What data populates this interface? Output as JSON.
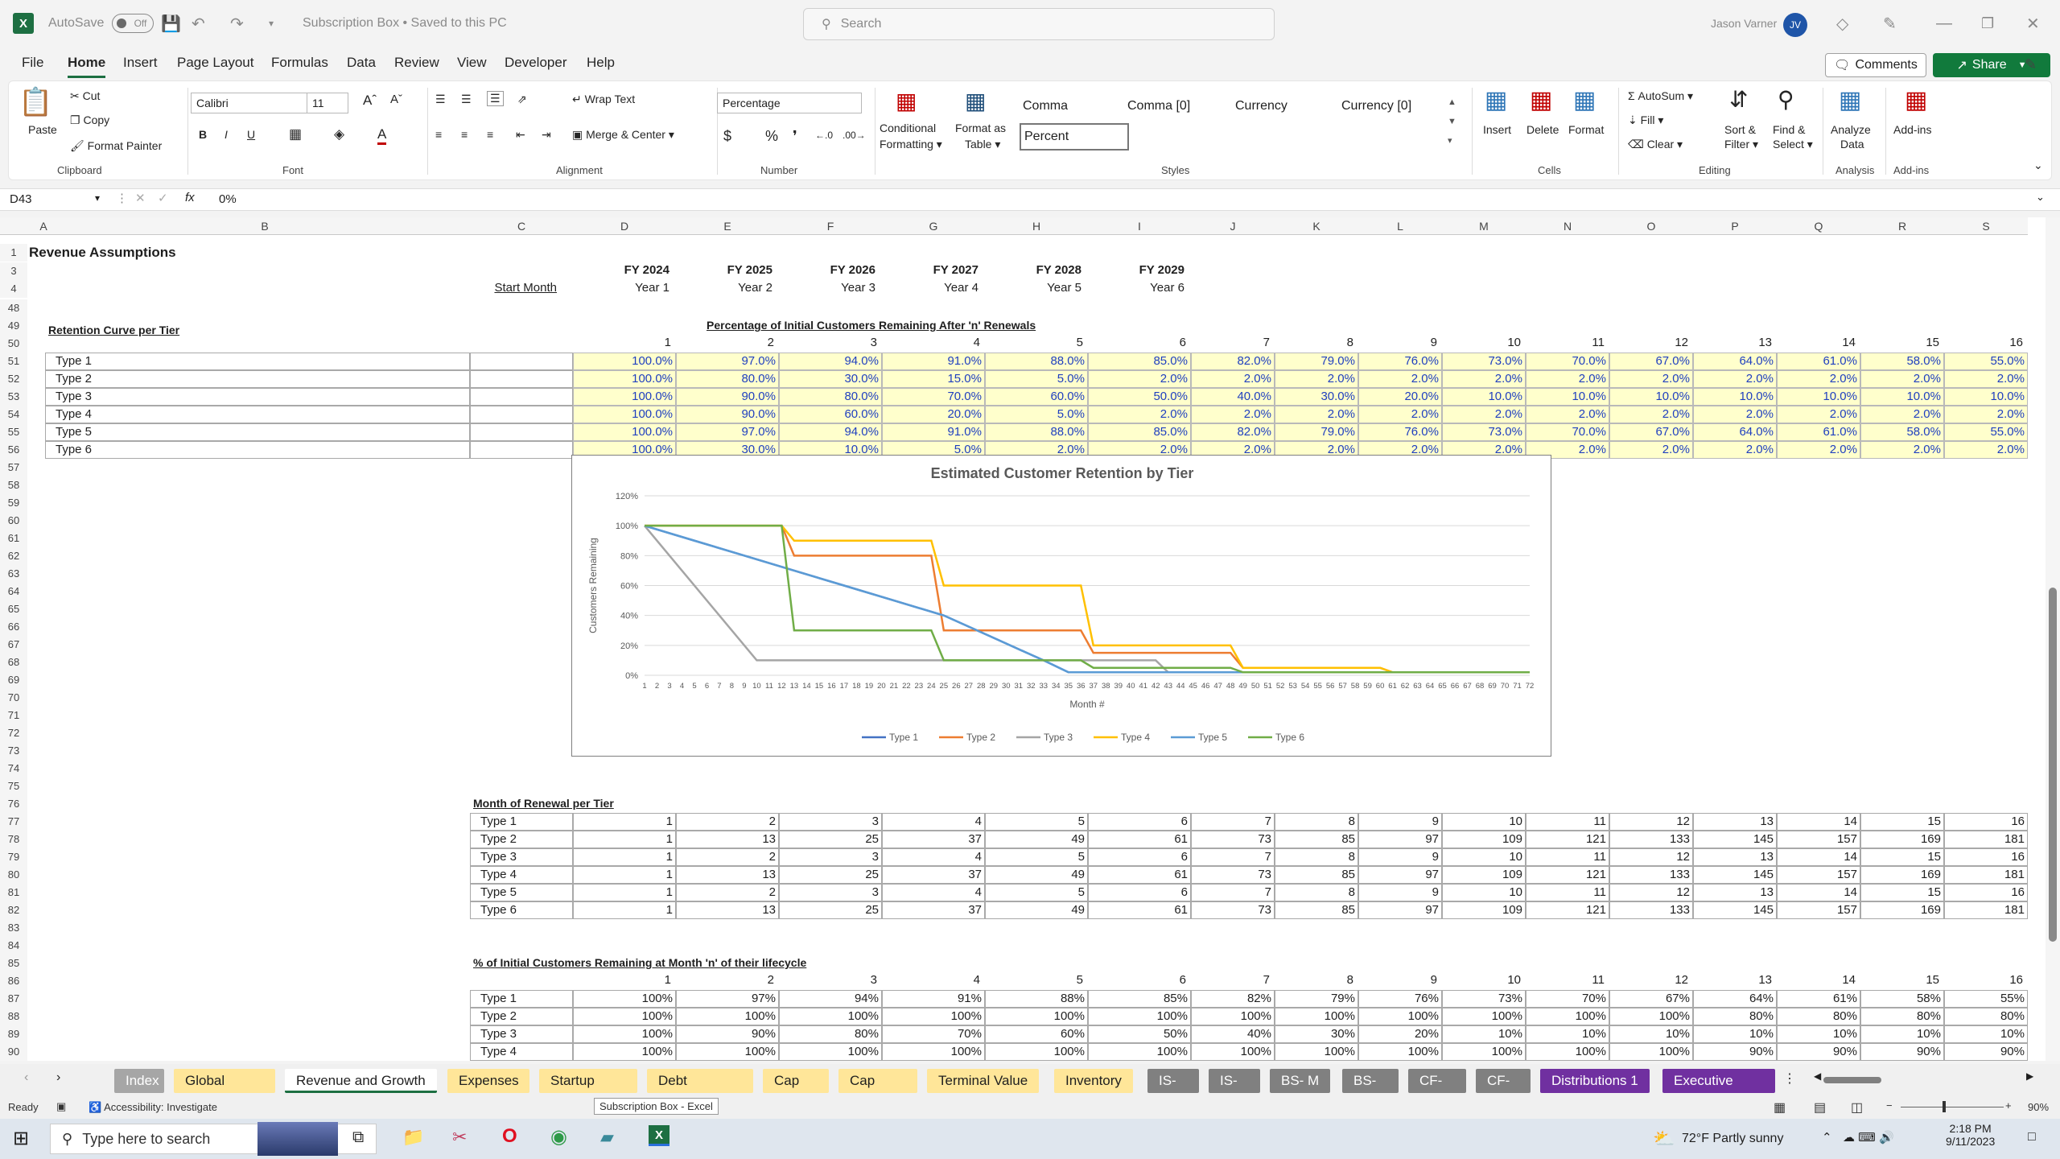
{
  "window": {
    "autosave_label": "AutoSave",
    "autosave_state": "Off",
    "title": "Subscription Box  •  Saved to this PC",
    "search_placeholder": "Search",
    "user_name": "Jason Varner",
    "user_initials": "JV"
  },
  "menu": {
    "tabs": [
      "File",
      "Home",
      "Insert",
      "Page Layout",
      "Formulas",
      "Data",
      "Review",
      "View",
      "Developer",
      "Help"
    ],
    "active": "Home",
    "comments": "Comments",
    "share": "Share"
  },
  "ribbon": {
    "clipboard": {
      "paste": "Paste",
      "cut": "Cut",
      "copy": "Copy",
      "format_painter": "Format Painter",
      "label": "Clipboard"
    },
    "font": {
      "name": "Calibri",
      "size": "11",
      "label": "Font"
    },
    "alignment": {
      "wrap": "Wrap Text",
      "merge": "Merge & Center",
      "label": "Alignment"
    },
    "number": {
      "format": "Percentage",
      "label": "Number"
    },
    "styles": {
      "cond1": "Conditional",
      "cond2": "Formatting",
      "fmt1": "Format as",
      "fmt2": "Table",
      "cells": [
        "Comma",
        "Comma [0]",
        "Currency",
        "Currency [0]",
        "Percent"
      ],
      "label": "Styles"
    },
    "cells": {
      "insert": "Insert",
      "delete": "Delete",
      "format": "Format",
      "label": "Cells"
    },
    "editing": {
      "autosum": "AutoSum",
      "fill": "Fill",
      "clear": "Clear",
      "sort1": "Sort &",
      "sort2": "Filter",
      "find1": "Find &",
      "find2": "Select",
      "label": "Editing"
    },
    "analysis": {
      "analyze1": "Analyze",
      "analyze2": "Data",
      "label": "Analysis"
    },
    "addins": {
      "addins": "Add-ins",
      "label": "Add-ins"
    }
  },
  "formula_bar": {
    "cell_ref": "D43",
    "formula": "0%"
  },
  "columns": [
    "A",
    "B",
    "C",
    "D",
    "E",
    "F",
    "G",
    "H",
    "I",
    "J",
    "K",
    "L",
    "M",
    "N",
    "O",
    "P",
    "Q",
    "R",
    "S"
  ],
  "rows": [
    "1",
    "3",
    "4",
    "48",
    "49",
    "50",
    "51",
    "52",
    "53",
    "54",
    "55",
    "56",
    "57",
    "58",
    "59",
    "60",
    "61",
    "62",
    "63",
    "64",
    "65",
    "66",
    "67",
    "68",
    "69",
    "70",
    "71",
    "72",
    "73",
    "74",
    "75",
    "76",
    "77",
    "78",
    "79",
    "80",
    "81",
    "82",
    "83",
    "84",
    "85",
    "86",
    "87",
    "88",
    "89",
    "90"
  ],
  "sheet": {
    "title": "Revenue Assumptions",
    "fy": [
      "FY 2024",
      "FY 2025",
      "FY 2026",
      "FY 2027",
      "FY 2028",
      "FY 2029"
    ],
    "years": [
      "Year 1",
      "Year 2",
      "Year 3",
      "Year 4",
      "Year 5",
      "Year 6"
    ],
    "start_month": "Start Month",
    "retention_title": "Retention Curve per Tier",
    "retention_subtitle": "Percentage of Initial Customers Remaining After 'n' Renewals",
    "renewal_numbers": [
      "1",
      "2",
      "3",
      "4",
      "5",
      "6",
      "7",
      "8",
      "9",
      "10",
      "11",
      "12",
      "13",
      "14",
      "15",
      "16"
    ],
    "types": [
      "Type 1",
      "Type 2",
      "Type 3",
      "Type 4",
      "Type 5",
      "Type 6"
    ],
    "retention": [
      [
        "100.0%",
        "97.0%",
        "94.0%",
        "91.0%",
        "88.0%",
        "85.0%",
        "82.0%",
        "79.0%",
        "76.0%",
        "73.0%",
        "70.0%",
        "67.0%",
        "64.0%",
        "61.0%",
        "58.0%",
        "55.0%"
      ],
      [
        "100.0%",
        "80.0%",
        "30.0%",
        "15.0%",
        "5.0%",
        "2.0%",
        "2.0%",
        "2.0%",
        "2.0%",
        "2.0%",
        "2.0%",
        "2.0%",
        "2.0%",
        "2.0%",
        "2.0%",
        "2.0%"
      ],
      [
        "100.0%",
        "90.0%",
        "80.0%",
        "70.0%",
        "60.0%",
        "50.0%",
        "40.0%",
        "30.0%",
        "20.0%",
        "10.0%",
        "10.0%",
        "10.0%",
        "10.0%",
        "10.0%",
        "10.0%",
        "10.0%"
      ],
      [
        "100.0%",
        "90.0%",
        "60.0%",
        "20.0%",
        "5.0%",
        "2.0%",
        "2.0%",
        "2.0%",
        "2.0%",
        "2.0%",
        "2.0%",
        "2.0%",
        "2.0%",
        "2.0%",
        "2.0%",
        "2.0%"
      ],
      [
        "100.0%",
        "97.0%",
        "94.0%",
        "91.0%",
        "88.0%",
        "85.0%",
        "82.0%",
        "79.0%",
        "76.0%",
        "73.0%",
        "70.0%",
        "67.0%",
        "64.0%",
        "61.0%",
        "58.0%",
        "55.0%"
      ],
      [
        "100.0%",
        "30.0%",
        "10.0%",
        "5.0%",
        "2.0%",
        "2.0%",
        "2.0%",
        "2.0%",
        "2.0%",
        "2.0%",
        "2.0%",
        "2.0%",
        "2.0%",
        "2.0%",
        "2.0%",
        "2.0%"
      ]
    ],
    "month_title": "Month of Renewal per Tier",
    "month_renewal": [
      [
        "1",
        "2",
        "3",
        "4",
        "5",
        "6",
        "7",
        "8",
        "9",
        "10",
        "11",
        "12",
        "13",
        "14",
        "15",
        "16"
      ],
      [
        "1",
        "13",
        "25",
        "37",
        "49",
        "61",
        "73",
        "85",
        "97",
        "109",
        "121",
        "133",
        "145",
        "157",
        "169",
        "181"
      ],
      [
        "1",
        "2",
        "3",
        "4",
        "5",
        "6",
        "7",
        "8",
        "9",
        "10",
        "11",
        "12",
        "13",
        "14",
        "15",
        "16"
      ],
      [
        "1",
        "13",
        "25",
        "37",
        "49",
        "61",
        "73",
        "85",
        "97",
        "109",
        "121",
        "133",
        "145",
        "157",
        "169",
        "181"
      ],
      [
        "1",
        "2",
        "3",
        "4",
        "5",
        "6",
        "7",
        "8",
        "9",
        "10",
        "11",
        "12",
        "13",
        "14",
        "15",
        "16"
      ],
      [
        "1",
        "13",
        "25",
        "37",
        "49",
        "61",
        "73",
        "85",
        "97",
        "109",
        "121",
        "133",
        "145",
        "157",
        "169",
        "181"
      ]
    ],
    "pct_title": "% of Initial Customers Remaining at Month 'n' of their lifecycle",
    "pct_remaining": [
      [
        "100%",
        "97%",
        "94%",
        "91%",
        "88%",
        "85%",
        "82%",
        "79%",
        "76%",
        "73%",
        "70%",
        "67%",
        "64%",
        "61%",
        "58%",
        "55%"
      ],
      [
        "100%",
        "100%",
        "100%",
        "100%",
        "100%",
        "100%",
        "100%",
        "100%",
        "100%",
        "100%",
        "100%",
        "100%",
        "80%",
        "80%",
        "80%",
        "80%"
      ],
      [
        "100%",
        "90%",
        "80%",
        "70%",
        "60%",
        "50%",
        "40%",
        "30%",
        "20%",
        "10%",
        "10%",
        "10%",
        "10%",
        "10%",
        "10%",
        "10%"
      ],
      [
        "100%",
        "100%",
        "100%",
        "100%",
        "100%",
        "100%",
        "100%",
        "100%",
        "100%",
        "100%",
        "100%",
        "100%",
        "90%",
        "90%",
        "90%",
        "90%"
      ]
    ]
  },
  "chart_data": {
    "type": "line",
    "title": "Estimated Customer Retention by Tier",
    "xlabel": "Month #",
    "ylabel": "Customers Remaining",
    "ylim": [
      0,
      1.2
    ],
    "yticks": [
      "0%",
      "20%",
      "40%",
      "60%",
      "80%",
      "100%",
      "120%"
    ],
    "x": [
      1,
      72
    ],
    "legend_position": "bottom",
    "series": [
      {
        "name": "Type 1",
        "color": "#4472c4",
        "points": [
          [
            1,
            1.0
          ],
          [
            5,
            0.9
          ],
          [
            9,
            0.8
          ],
          [
            13,
            0.7
          ],
          [
            17,
            0.6
          ],
          [
            21,
            0.5
          ],
          [
            25,
            0.4
          ],
          [
            29,
            0.25
          ],
          [
            33,
            0.1
          ],
          [
            35,
            0.02
          ],
          [
            72,
            0.02
          ]
        ]
      },
      {
        "name": "Type 2",
        "color": "#ed7d31",
        "points": [
          [
            1,
            1.0
          ],
          [
            12,
            1.0
          ],
          [
            13,
            0.8
          ],
          [
            24,
            0.8
          ],
          [
            25,
            0.3
          ],
          [
            36,
            0.3
          ],
          [
            37,
            0.15
          ],
          [
            48,
            0.15
          ],
          [
            49,
            0.05
          ],
          [
            60,
            0.05
          ],
          [
            61,
            0.02
          ],
          [
            72,
            0.02
          ]
        ]
      },
      {
        "name": "Type 3",
        "color": "#a5a5a5",
        "points": [
          [
            1,
            1.0
          ],
          [
            10,
            0.1
          ],
          [
            42,
            0.1
          ],
          [
            43,
            0.02
          ],
          [
            72,
            0.02
          ]
        ]
      },
      {
        "name": "Type 4",
        "color": "#ffc000",
        "points": [
          [
            1,
            1.0
          ],
          [
            12,
            1.0
          ],
          [
            13,
            0.9
          ],
          [
            24,
            0.9
          ],
          [
            25,
            0.6
          ],
          [
            36,
            0.6
          ],
          [
            37,
            0.2
          ],
          [
            48,
            0.2
          ],
          [
            49,
            0.05
          ],
          [
            60,
            0.05
          ],
          [
            61,
            0.02
          ],
          [
            72,
            0.02
          ]
        ]
      },
      {
        "name": "Type 5",
        "color": "#5b9bd5",
        "points": [
          [
            1,
            1.0
          ],
          [
            5,
            0.9
          ],
          [
            9,
            0.8
          ],
          [
            13,
            0.7
          ],
          [
            17,
            0.6
          ],
          [
            21,
            0.5
          ],
          [
            25,
            0.4
          ],
          [
            29,
            0.25
          ],
          [
            33,
            0.1
          ],
          [
            35,
            0.02
          ],
          [
            72,
            0.02
          ]
        ]
      },
      {
        "name": "Type 6",
        "color": "#70ad47",
        "points": [
          [
            1,
            1.0
          ],
          [
            12,
            1.0
          ],
          [
            13,
            0.3
          ],
          [
            24,
            0.3
          ],
          [
            25,
            0.1
          ],
          [
            36,
            0.1
          ],
          [
            37,
            0.05
          ],
          [
            48,
            0.05
          ],
          [
            49,
            0.02
          ],
          [
            72,
            0.02
          ]
        ]
      }
    ]
  },
  "sheet_tabs": [
    {
      "label": "Index",
      "bg": "#a6a6a6",
      "fg": "#fff"
    },
    {
      "label": "Global Control",
      "bg": "#ffe699",
      "fg": "#1f1f1f"
    },
    {
      "label": "Revenue and Growth",
      "bg": "#ffffff",
      "fg": "#1f1f1f"
    },
    {
      "label": "Expenses",
      "bg": "#ffe699",
      "fg": "#1f1f1f"
    },
    {
      "label": "Startup Costs",
      "bg": "#ffe699",
      "fg": "#1f1f1f"
    },
    {
      "label": "Debt Schedule",
      "bg": "#ffe699",
      "fg": "#1f1f1f"
    },
    {
      "label": "Cap Ex",
      "bg": "#ffe699",
      "fg": "#1f1f1f"
    },
    {
      "label": "Cap Table",
      "bg": "#ffe699",
      "fg": "#1f1f1f"
    },
    {
      "label": "Terminal Value",
      "bg": "#ffe699",
      "fg": "#1f1f1f"
    },
    {
      "label": "Inventory",
      "bg": "#ffe699",
      "fg": "#1f1f1f"
    },
    {
      "label": "IS- M",
      "bg": "#808080",
      "fg": "#fff"
    },
    {
      "label": "IS- A",
      "bg": "#808080",
      "fg": "#fff"
    },
    {
      "label": "BS- M",
      "bg": "#808080",
      "fg": "#fff"
    },
    {
      "label": "BS- A",
      "bg": "#808080",
      "fg": "#fff"
    },
    {
      "label": "CF- M",
      "bg": "#808080",
      "fg": "#fff"
    },
    {
      "label": "CF- A",
      "bg": "#808080",
      "fg": "#fff"
    },
    {
      "label": "Distributions 1",
      "bg": "#7030a0",
      "fg": "#fff"
    },
    {
      "label": "Executive Summ",
      "bg": "#7030a0",
      "fg": "#fff"
    }
  ],
  "status": {
    "ready": "Ready",
    "accessibility": "Accessibility: Investigate",
    "tooltip": "Subscription Box - Excel",
    "zoom": "90%"
  },
  "taskbar": {
    "search": "Type here to search",
    "weather": "72°F  Partly sunny",
    "time": "2:18 PM",
    "date": "9/11/2023"
  }
}
